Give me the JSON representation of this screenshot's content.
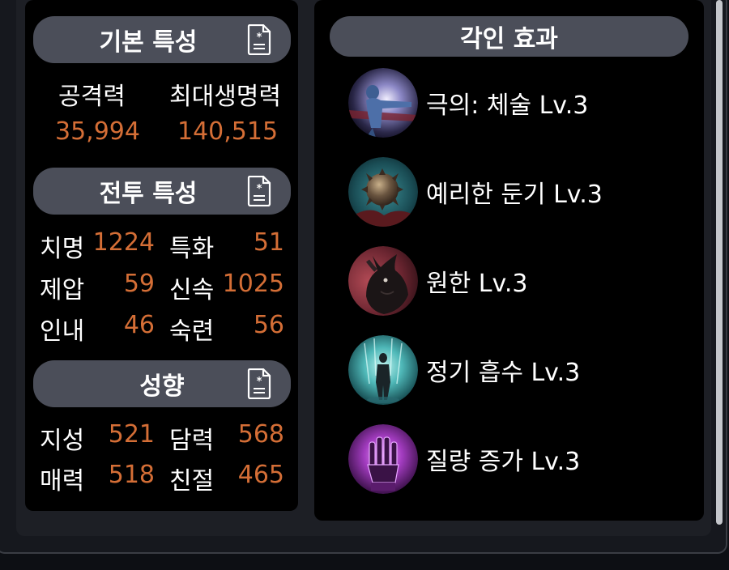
{
  "basic": {
    "title": "기본 특성",
    "attack_label": "공격력",
    "attack_value": "35,994",
    "hp_label": "최대생명력",
    "hp_value": "140,515"
  },
  "combat": {
    "title": "전투 특성",
    "stats": [
      {
        "label": "치명",
        "value": "1224"
      },
      {
        "label": "특화",
        "value": "51"
      },
      {
        "label": "제압",
        "value": "59"
      },
      {
        "label": "신속",
        "value": "1025"
      },
      {
        "label": "인내",
        "value": "46"
      },
      {
        "label": "숙련",
        "value": "56"
      }
    ]
  },
  "tendency": {
    "title": "성향",
    "stats": [
      {
        "label": "지성",
        "value": "521"
      },
      {
        "label": "담력",
        "value": "568"
      },
      {
        "label": "매력",
        "value": "518"
      },
      {
        "label": "친절",
        "value": "465"
      }
    ]
  },
  "engraving": {
    "title": "각인 효과",
    "items": [
      {
        "label": "극의: 체술 Lv.3",
        "icon": "martial-artist-icon"
      },
      {
        "label": "예리한 둔기 Lv.3",
        "icon": "spiked-mace-icon"
      },
      {
        "label": "원한 Lv.3",
        "icon": "demon-beast-icon"
      },
      {
        "label": "정기 흡수 Lv.3",
        "icon": "energy-absorb-icon"
      },
      {
        "label": "질량 증가 Lv.3",
        "icon": "purple-gauntlet-icon"
      }
    ]
  },
  "colors": {
    "value_accent": "#d46e36",
    "pill_bg": "#4b4e59",
    "panel_bg": "#000000"
  }
}
